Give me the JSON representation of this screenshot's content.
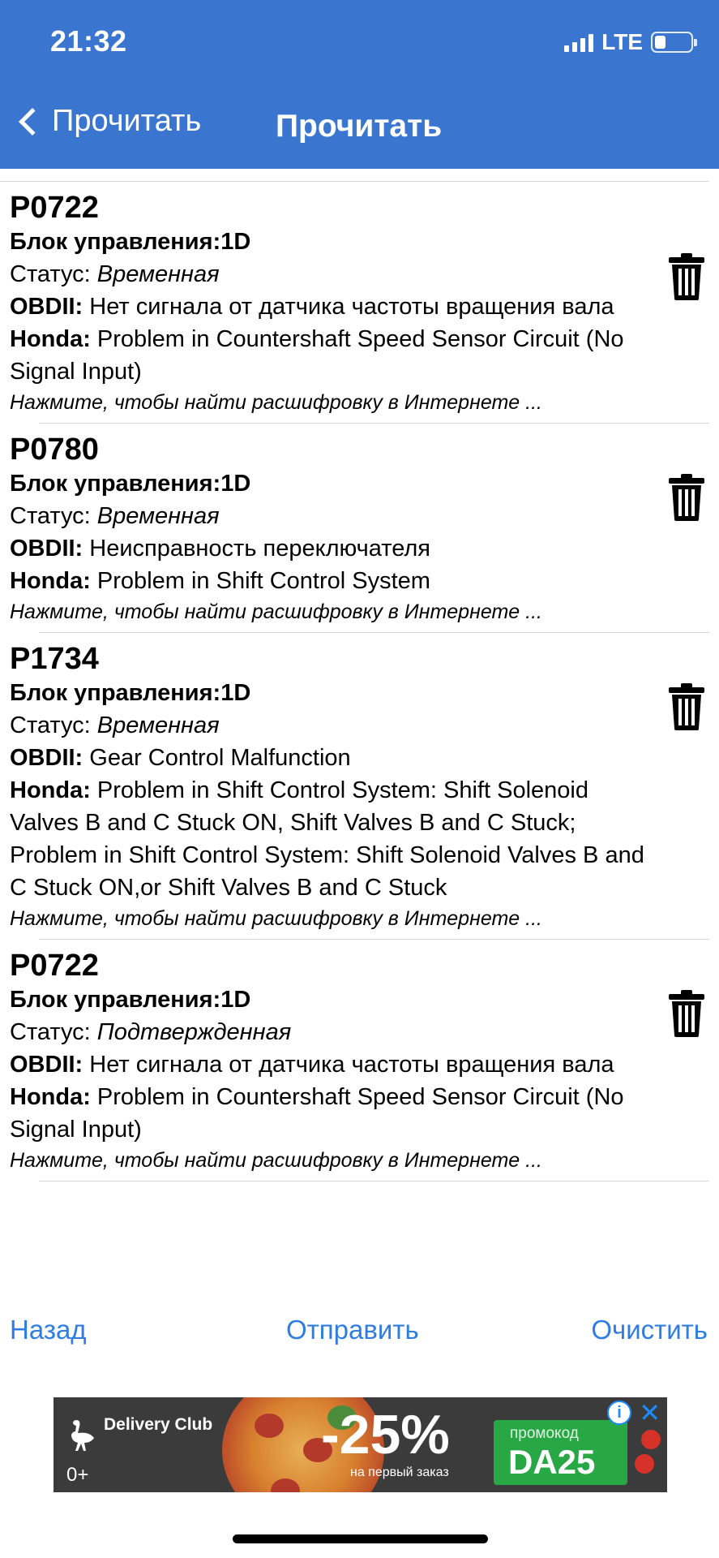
{
  "status_bar": {
    "time": "21:32",
    "network": "LTE",
    "battery_level": 0.3
  },
  "nav": {
    "back_label": "Прочитать",
    "title": "Прочитать"
  },
  "items": [
    {
      "code": "P0722",
      "block_label": "Блок управления:",
      "block_value": "1D",
      "status_label": "Статус: ",
      "status_value": "Временная",
      "obd_label": "OBDII:",
      "obd_text": " Нет сигнала от датчика частоты вращения вала",
      "make_label": "Honda:",
      "make_text": " Problem in Countershaft Speed Sensor Circuit (No Signal Input)",
      "hint": "Нажмите, чтобы найти расшифровку в Интернете ..."
    },
    {
      "code": "P0780",
      "block_label": "Блок управления:",
      "block_value": "1D",
      "status_label": "Статус: ",
      "status_value": "Временная",
      "obd_label": "OBDII:",
      "obd_text": " Неисправность переключателя",
      "make_label": "Honda:",
      "make_text": " Problem in Shift Control System",
      "hint": "Нажмите, чтобы найти расшифровку в Интернете ..."
    },
    {
      "code": "P1734",
      "block_label": "Блок управления:",
      "block_value": "1D",
      "status_label": "Статус: ",
      "status_value": "Временная",
      "obd_label": "OBDII:",
      "obd_text": " Gear Control Malfunction",
      "make_label": "Honda:",
      "make_text": " Problem in Shift Control System: Shift Solenoid Valves B and C Stuck ON, Shift Valves B and C Stuck; Problem in Shift Control System: Shift Solenoid Valves B and C Stuck ON,or Shift Valves B and C Stuck",
      "hint": "Нажмите, чтобы найти расшифровку в Интернете ..."
    },
    {
      "code": "P0722",
      "block_label": "Блок управления:",
      "block_value": "1D",
      "status_label": "Статус: ",
      "status_value": "Подтвержденная",
      "obd_label": "OBDII:",
      "obd_text": " Нет сигнала от датчика частоты вращения вала",
      "make_label": "Honda:",
      "make_text": " Problem in Countershaft Speed Sensor Circuit (No Signal Input)",
      "hint": "Нажмите, чтобы найти расшифровку в Интернете ..."
    }
  ],
  "actions": {
    "back": "Назад",
    "send": "Отправить",
    "clear": "Очистить"
  },
  "ad": {
    "brand": "Delivery Club",
    "age_rating": "0+",
    "discount": "-25%",
    "discount_sub": "на первый заказ",
    "promo_label": "промокод",
    "promo_code": "DA25",
    "info_icon": "i",
    "close_icon": "✕"
  },
  "colors": {
    "header": "#3a76cf",
    "link": "#2f7de1",
    "promo": "#28a745"
  }
}
